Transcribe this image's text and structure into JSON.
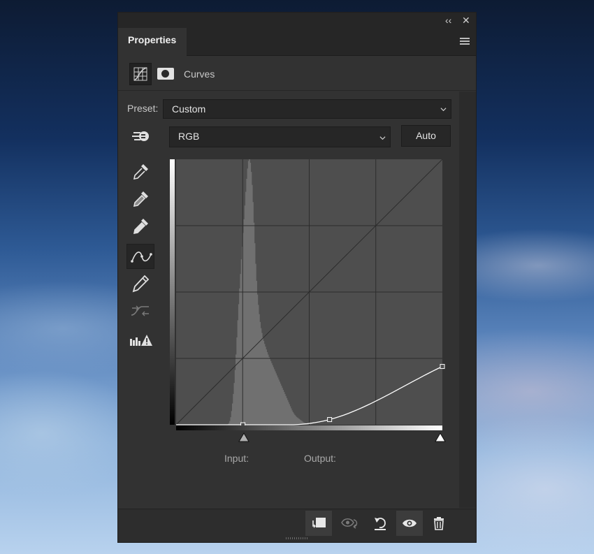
{
  "window": {
    "collapse_glyph": "‹‹",
    "close_glyph": "✕"
  },
  "panel": {
    "tab_label": "Properties",
    "menu_icon": "hamburger-menu-icon"
  },
  "header": {
    "title": "Curves",
    "curves_icon": "curves-adjustment-icon",
    "mask_icon": "layer-mask-icon"
  },
  "preset": {
    "label": "Preset:",
    "value": "Custom"
  },
  "channel": {
    "value": "RGB"
  },
  "auto_button": {
    "label": "Auto"
  },
  "tools": [
    {
      "name": "on-image-adjust-icon"
    },
    {
      "name": "black-point-eyedropper-icon"
    },
    {
      "name": "gray-point-eyedropper-icon"
    },
    {
      "name": "white-point-eyedropper-icon"
    },
    {
      "name": "curve-points-icon",
      "active": true
    },
    {
      "name": "pencil-icon"
    },
    {
      "name": "smooth-curve-icon",
      "disabled": true
    },
    {
      "name": "clipping-warning-icon"
    }
  ],
  "graph": {
    "input_label": "Input:",
    "output_label": "Output:",
    "points": [
      [
        0,
        0
      ],
      [
        64,
        0
      ],
      [
        147,
        5
      ],
      [
        255,
        56
      ]
    ],
    "histogram": [
      0,
      0,
      0,
      0,
      0,
      0,
      0,
      0,
      0,
      0,
      0,
      0,
      0,
      0,
      0,
      0,
      0,
      0,
      0,
      0,
      0,
      0,
      0,
      0,
      0,
      0,
      0,
      0,
      0,
      0,
      0,
      0,
      0,
      0,
      0,
      0,
      0,
      0,
      0,
      0,
      0,
      0,
      0,
      0,
      0,
      0,
      0,
      0,
      0,
      0,
      0,
      0,
      0,
      0,
      0,
      0,
      0,
      0,
      2,
      5,
      11,
      22,
      40,
      62,
      90,
      122,
      160,
      205,
      255,
      305,
      352,
      398,
      440,
      483,
      520,
      560,
      600,
      640,
      680,
      718,
      748,
      770,
      775,
      765,
      738,
      700,
      650,
      590,
      530,
      470,
      420,
      380,
      350,
      323,
      300,
      282,
      268,
      255,
      245,
      236,
      228,
      220,
      212,
      205,
      198,
      192,
      186,
      180,
      174,
      168,
      162,
      156,
      150,
      144,
      138,
      132,
      126,
      120,
      114,
      108,
      102,
      96,
      90,
      84,
      78,
      72,
      66,
      60,
      54,
      48,
      42,
      37,
      33,
      29,
      26,
      23,
      21,
      19,
      17,
      15,
      13,
      11,
      9,
      7,
      6,
      5,
      4,
      3,
      2,
      1,
      1,
      0,
      0,
      0,
      0,
      0,
      0,
      0,
      0,
      0,
      0,
      0,
      0,
      0,
      0,
      0,
      0,
      0,
      0,
      0,
      0,
      0,
      0,
      0,
      0,
      0,
      0,
      0,
      0,
      0,
      0,
      0,
      0,
      0,
      0,
      0,
      0,
      0,
      0,
      0,
      0,
      0,
      0,
      0,
      0,
      0,
      0,
      0,
      0,
      0,
      0,
      0,
      0,
      0,
      0,
      0,
      0,
      0,
      0,
      0,
      0,
      0,
      0,
      0,
      0,
      0,
      0,
      0,
      0,
      0,
      0,
      0,
      0,
      0,
      0,
      0,
      0,
      0,
      0,
      0,
      0,
      0,
      0,
      0,
      0,
      0,
      0,
      0,
      0,
      0,
      0,
      0,
      0,
      0,
      0,
      0,
      0,
      0,
      0,
      0,
      0,
      0,
      0,
      0,
      0,
      0,
      0,
      0,
      0,
      0,
      0,
      0,
      0,
      0,
      0,
      0,
      0,
      0,
      0,
      0,
      0,
      0,
      0,
      0,
      0,
      0,
      0,
      0,
      0,
      0,
      0,
      0,
      0,
      0,
      0,
      0,
      0,
      0,
      0,
      0,
      0,
      0,
      0,
      0,
      0,
      0,
      0,
      0,
      0,
      0
    ]
  },
  "footer": {
    "buttons": [
      {
        "name": "clip-to-layer-icon"
      },
      {
        "name": "view-previous-state-icon"
      },
      {
        "name": "reset-icon"
      },
      {
        "name": "visibility-eye-icon"
      },
      {
        "name": "delete-trash-icon"
      }
    ]
  },
  "colors": {
    "panel_bg": "#323232",
    "dark_bg": "#262626",
    "text": "#e4e4e4",
    "curve": "#ffffff"
  }
}
